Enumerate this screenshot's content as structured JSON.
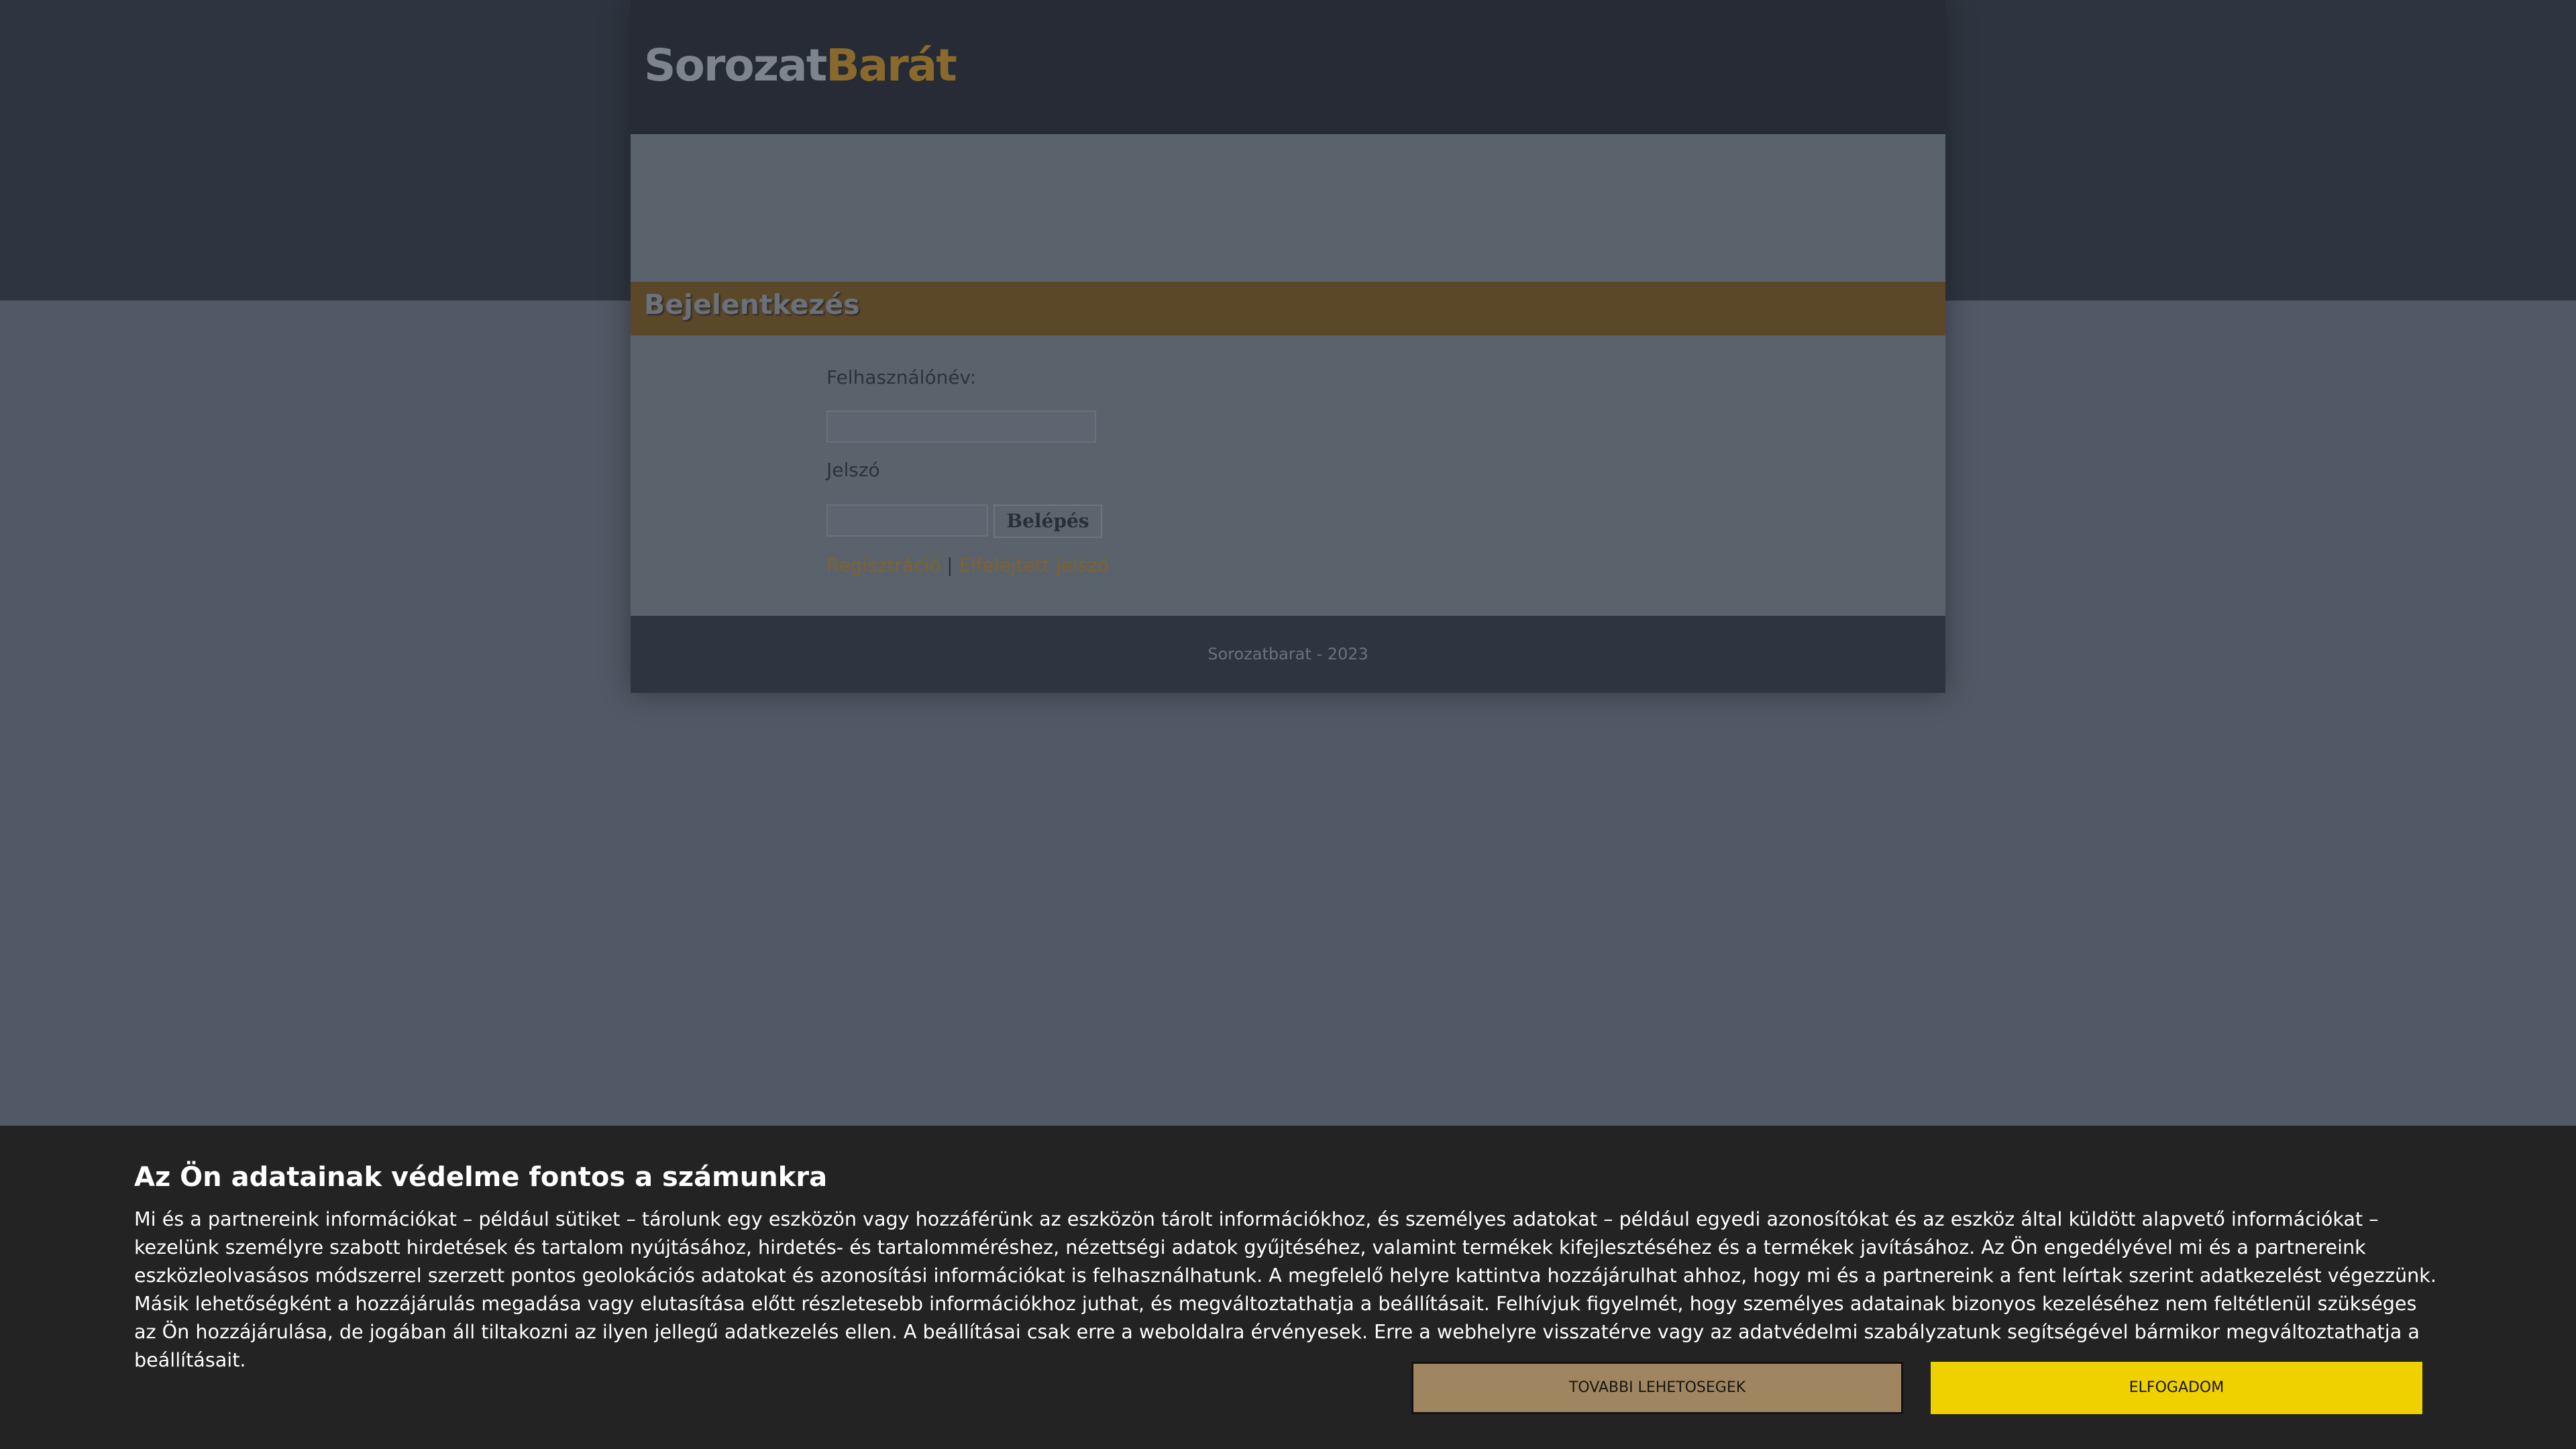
{
  "header": {
    "logo_part1": "Sorozat",
    "logo_part2": "Barát"
  },
  "login": {
    "title": "Bejelentkezés",
    "username_label": "Felhasználónév:",
    "password_label": "Jelszó",
    "submit_label": "Belépés",
    "register_link": "Regisztráció",
    "separator": "|",
    "forgot_link": "Elfelejtett jelszó"
  },
  "footer": {
    "text": "Sorozatbarat - 2023"
  },
  "cookie_banner": {
    "title": "Az Ön adatainak védelme fontos a számunkra",
    "body": "Mi és a partnereink információkat – például sütiket – tárolunk egy eszközön vagy hozzáférünk az eszközön tárolt információkhoz, és személyes adatokat – például egyedi azonosítókat és az eszköz által küldött alapvető információkat – kezelünk személyre szabott hirdetések és tartalom nyújtásához, hirdetés- és tartalomméréshez, nézettségi adatok gyűjtéséhez, valamint termékek kifejlesztéséhez és a termékek javításához. Az Ön engedélyével mi és a partnereink eszközleolvasásos módszerrel szerzett pontos geolokációs adatokat és azonosítási információkat is felhasználhatunk. A megfelelő helyre kattintva hozzájárulhat ahhoz, hogy mi és a partnereink a fent leírtak szerint adatkezelést végezzünk. Másik lehetőségként a hozzájárulás megadása vagy elutasítása előtt részletesebb információkhoz juthat, és megváltoztathatja a beállításait. Felhívjuk figyelmét, hogy személyes adatainak bizonyos kezeléséhez nem feltétlenül szükséges az Ön hozzájárulása, de jogában áll tiltakozni az ilyen jellegű adatkezelés ellen. A beállításai csak erre a weboldalra érvényesek. Erre a webhelyre visszatérve vagy az adatvédelmi szabályzatunk segítségével bármikor megváltoztathatja a beállításait.",
    "more_options_label": "TOVABBI LEHETOSEGEK",
    "accept_label": "ELFOGADOM"
  },
  "colors": {
    "accent_gold": "#8a6a2c",
    "accept_yellow": "#f0d100",
    "more_options_tan": "#a08660",
    "cookie_bg": "#232323"
  }
}
